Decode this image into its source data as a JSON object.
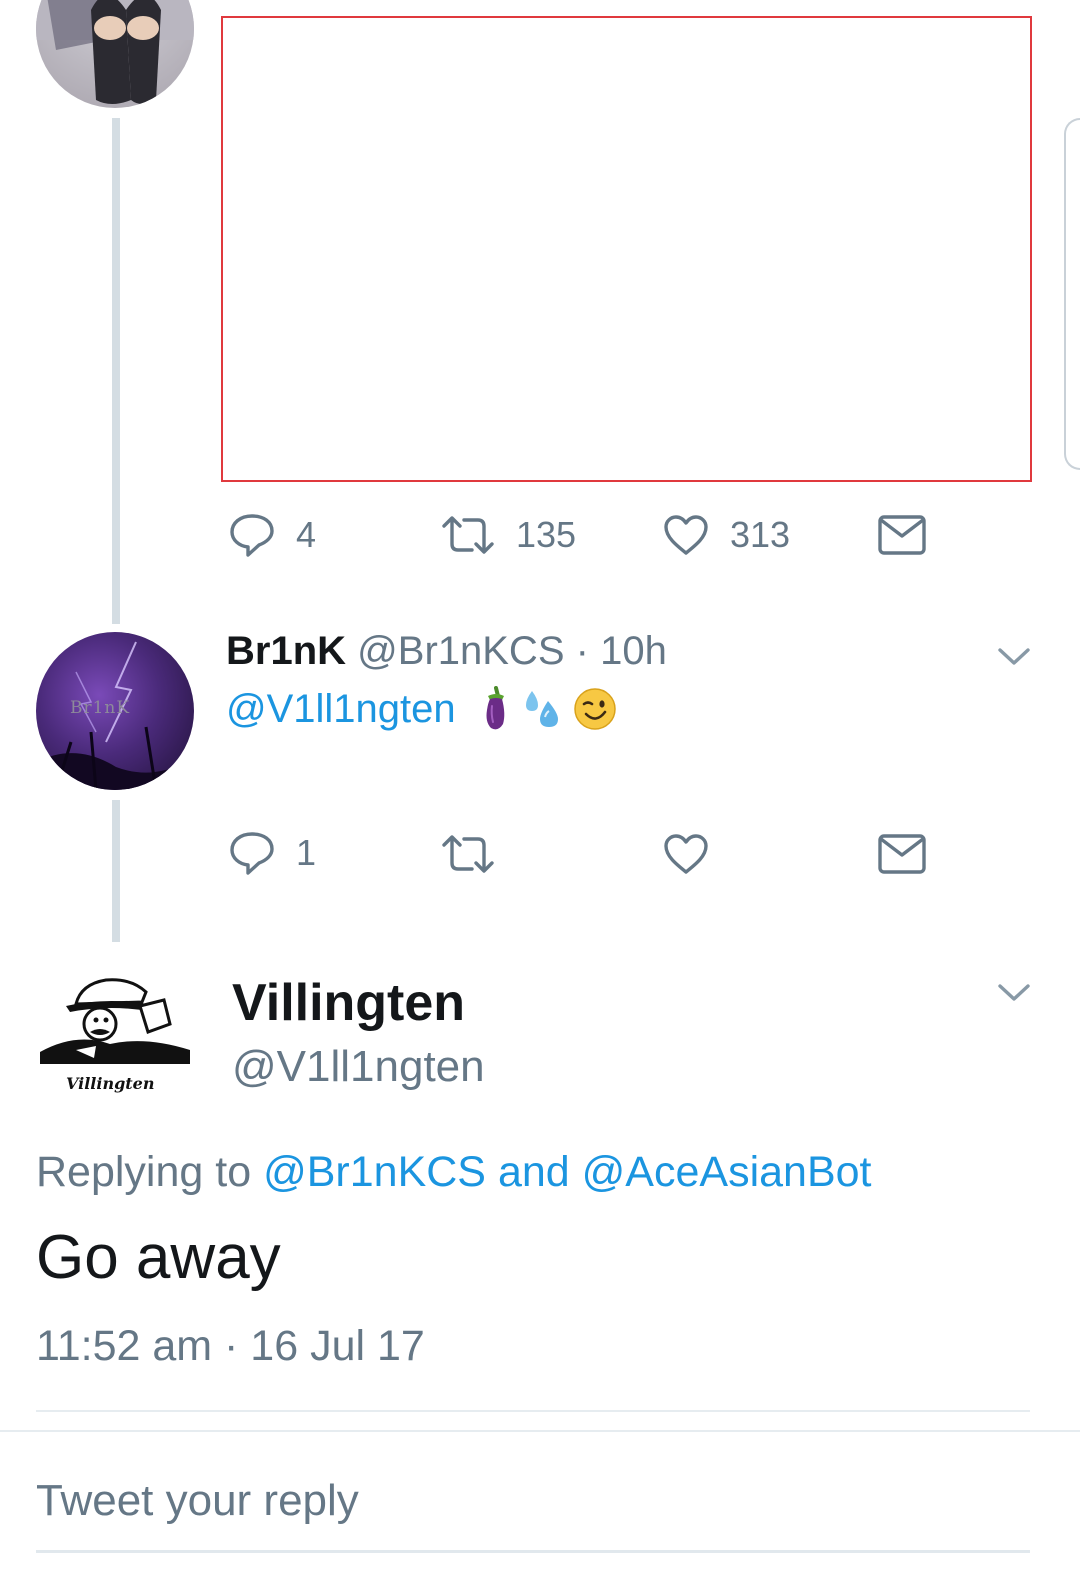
{
  "tweet_one": {
    "actions": {
      "reply_count": "4",
      "retweet_count": "135",
      "like_count": "313"
    }
  },
  "tweet_two": {
    "display_name": "Br1nK",
    "handle": "@Br1nKCS",
    "separator": "·",
    "time": "10h",
    "mention": "@V1ll1ngten",
    "avatar_text": "Br1nK",
    "actions": {
      "reply_count": "1",
      "retweet_count": "",
      "like_count": ""
    }
  },
  "focused_tweet": {
    "display_name": "Villingten",
    "handle": "@V1ll1ngten",
    "avatar_text": "Villingten",
    "replying_prefix": "Replying to",
    "replying_user_1": "@Br1nKCS",
    "replying_and": "and",
    "replying_user_2": "@AceAsianBot",
    "body": "Go away",
    "timestamp": "11:52 am · 16 Jul 17"
  },
  "reply_box": {
    "placeholder": "Tweet your reply"
  },
  "colors": {
    "link": "#1b95e0",
    "muted": "#657786",
    "thread_line": "#d4dde3",
    "media_border": "#e0393e"
  },
  "icons": [
    "reply-icon",
    "retweet-icon",
    "like-icon",
    "direct-message-icon",
    "chevron-down-icon",
    "eggplant-emoji",
    "sweat-droplets-emoji",
    "winking-face-emoji"
  ]
}
